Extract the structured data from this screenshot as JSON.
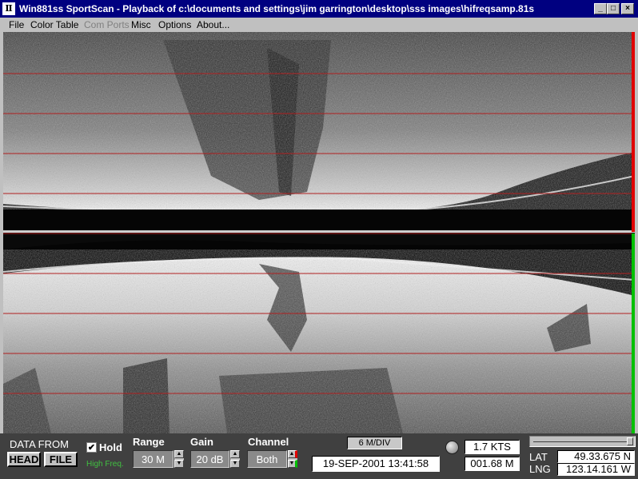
{
  "window": {
    "title": "Win881ss SportScan - Playback of c:\\documents and settings\\jim garrington\\desktop\\sss images\\hifreqsamp.81s",
    "app_icon_glyph": "Ⅱ",
    "minimize_glyph": "_",
    "maximize_glyph": "□",
    "close_glyph": "×"
  },
  "menu": [
    "File",
    "Color Table",
    "Com Ports",
    "Misc",
    "Options",
    "About..."
  ],
  "menu_disabled": [
    false,
    false,
    true,
    false,
    false,
    false
  ],
  "colors": {
    "title_bar": "#000080",
    "range_lines": "#b02020",
    "port_indicator": "#e00000",
    "starboard_indicator": "#00c000",
    "panel": "#404040"
  },
  "controls": {
    "data_from_label": "DATA FROM",
    "head_button": "HEAD",
    "file_button": "FILE",
    "hold_label": "Hold",
    "hold_checked": "✔",
    "high_freq_label": "High Freq.",
    "range_label": "Range",
    "range_value": "30 M",
    "gain_label": "Gain",
    "gain_value": "20 dB",
    "channel_label": "Channel",
    "channel_value": "Both",
    "scale_label": "6 M/DIV",
    "date_time": "19-SEP-2001  13:41:58",
    "speed": "1.7 KTS",
    "distance": "001.68 M",
    "lat_label": "LAT",
    "lng_label": "LNG",
    "lat_value": "49.33.675 N",
    "lng_value": "123.14.161 W",
    "spin_up_glyph": "▲",
    "spin_down_glyph": "▼"
  }
}
